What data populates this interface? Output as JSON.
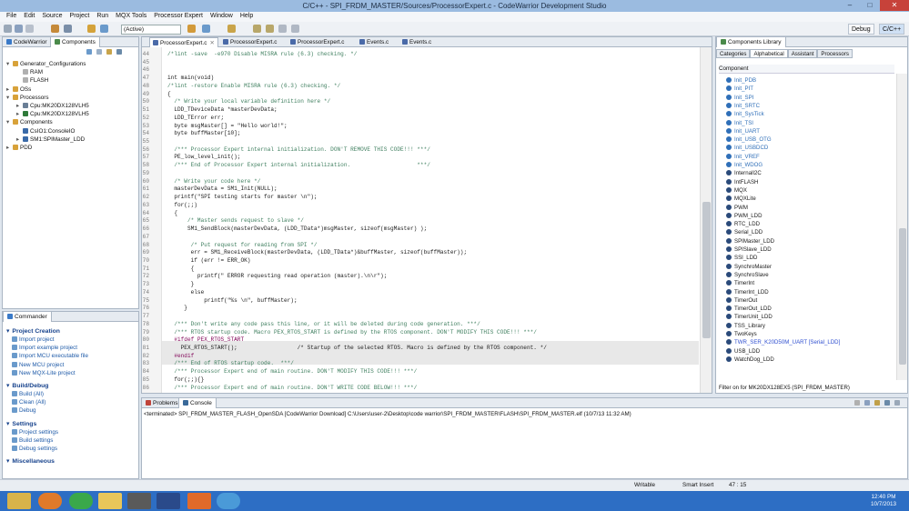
{
  "window": {
    "title": "C/C++ - SPI_FRDM_MASTER/Sources/ProcessorExpert.c - CodeWarrior Development Studio",
    "minimize": "–",
    "maximize": "□",
    "close": "✕"
  },
  "menu": [
    "File",
    "Edit",
    "Source",
    "Project",
    "Run",
    "MQX Tools",
    "Processor Expert",
    "Window",
    "Help"
  ],
  "toolbar": {
    "active_config": "(Active)",
    "perspectives": [
      "Debug",
      "C/C++"
    ]
  },
  "left_panel": {
    "tabs": [
      "CodeWarrior",
      "Components"
    ],
    "tree": [
      {
        "indent": 0,
        "label": "Generator_Configurations",
        "arrow": "▾",
        "color": "#d8a23a"
      },
      {
        "indent": 1,
        "label": "RAM",
        "arrow": "",
        "color": "#b0b0b0"
      },
      {
        "indent": 1,
        "label": "FLASH",
        "arrow": "",
        "color": "#b0b0b0"
      },
      {
        "indent": 0,
        "label": "OSs",
        "arrow": "▸",
        "color": "#d8a23a"
      },
      {
        "indent": 0,
        "label": "Processors",
        "arrow": "▾",
        "color": "#d8a23a"
      },
      {
        "indent": 1,
        "label": "Cpu:MK20DX128VLH5",
        "arrow": "▸",
        "color": "#6a7f96"
      },
      {
        "indent": 1,
        "label": "Cpu:MK20DX128VLH5",
        "arrow": "▸",
        "color": "#2f7a3a"
      },
      {
        "indent": 0,
        "label": "Components",
        "arrow": "▾",
        "color": "#d8a23a"
      },
      {
        "indent": 1,
        "label": "CsIO1:ConsoleIO",
        "arrow": "",
        "color": "#3a6aa8"
      },
      {
        "indent": 1,
        "label": "SM1:SPIMaster_LDD",
        "arrow": "▸",
        "color": "#3a6aa8"
      },
      {
        "indent": 0,
        "label": "PDD",
        "arrow": "▸",
        "color": "#d8a23a"
      }
    ]
  },
  "commander": {
    "title": "Commander",
    "sections": [
      {
        "title": "Project Creation",
        "items": [
          "Import project",
          "Import example project",
          "Import MCU executable file",
          "New MCU project",
          "New MQX-Lite project"
        ]
      },
      {
        "title": "Build/Debug",
        "items": [
          "Build  (All)",
          "Clean  (All)",
          "Debug"
        ]
      },
      {
        "title": "Settings",
        "items": [
          "Project settings",
          "Build settings",
          "Debug settings"
        ]
      },
      {
        "title": "Miscellaneous",
        "items": []
      }
    ]
  },
  "editor": {
    "tabs": [
      "ProcessorExpert.c",
      "ProcessorExpert.c",
      "ProcessorExpert.c",
      "Events.c",
      "Events.c"
    ],
    "lines": [
      {
        "n": "44",
        "t": "/*lint -save  -e970 Disable MISRA rule (6.3) checking. */",
        "c": "#3f7f5f"
      },
      {
        "n": "45",
        "t": "",
        "c": "#1a1a1a"
      },
      {
        "n": "46",
        "t": "",
        "c": "#1a1a1a"
      },
      {
        "n": "47",
        "t": "int main(void)",
        "c": "#1a1a1a"
      },
      {
        "n": "48",
        "t": "/*lint -restore Enable MISRA rule (6.3) checking. */",
        "c": "#3f7f5f"
      },
      {
        "n": "49",
        "t": "{",
        "c": "#1a1a1a"
      },
      {
        "n": "50",
        "t": "  /* Write your local variable definition here */",
        "c": "#3f7f5f"
      },
      {
        "n": "51",
        "t": "  LDD_TDeviceData *masterDevData;",
        "c": "#1a1a1a"
      },
      {
        "n": "52",
        "t": "  LDD_TError err;",
        "c": "#1a1a1a"
      },
      {
        "n": "53",
        "t": "  byte msgMaster[] = \"Hello world!\";",
        "c": "#1a1a1a"
      },
      {
        "n": "54",
        "t": "  byte buffMaster[10];",
        "c": "#1a1a1a"
      },
      {
        "n": "55",
        "t": "",
        "c": "#1a1a1a"
      },
      {
        "n": "56",
        "t": "  /*** Processor Expert internal initialization. DON'T REMOVE THIS CODE!!! ***/",
        "c": "#3f7f5f"
      },
      {
        "n": "57",
        "t": "  PE_low_level_init();",
        "c": "#1a1a1a"
      },
      {
        "n": "58",
        "t": "  /*** End of Processor Expert internal initialization.                    ***/",
        "c": "#3f7f5f"
      },
      {
        "n": "59",
        "t": "",
        "c": "#1a1a1a"
      },
      {
        "n": "60",
        "t": "  /* Write your code here */",
        "c": "#3f7f5f"
      },
      {
        "n": "61",
        "t": "  masterDevData = SM1_Init(NULL);",
        "c": "#1a1a1a"
      },
      {
        "n": "62",
        "t": "  printf(\"SPI testing starts for master \\n\");",
        "c": "#1a1a1a"
      },
      {
        "n": "63",
        "t": "  for(;;)",
        "c": "#1a1a1a"
      },
      {
        "n": "64",
        "t": "  {",
        "c": "#1a1a1a"
      },
      {
        "n": "65",
        "t": "      /* Master sends request to slave */",
        "c": "#3f7f5f"
      },
      {
        "n": "66",
        "t": "      SM1_SendBlock(masterDevData, (LDD_TData*)msgMaster, sizeof(msgMaster) );",
        "c": "#1a1a1a"
      },
      {
        "n": "67",
        "t": "",
        "c": "#1a1a1a"
      },
      {
        "n": "68",
        "t": "       /* Put request for reading from SPI */",
        "c": "#3f7f5f"
      },
      {
        "n": "69",
        "t": "       err = SM1_ReceiveBlock(masterDevData, (LDD_TData*)&buffMaster, sizeof(buffMaster));",
        "c": "#1a1a1a"
      },
      {
        "n": "70",
        "t": "       if (err != ERR_OK)",
        "c": "#1a1a1a"
      },
      {
        "n": "71",
        "t": "       {",
        "c": "#1a1a1a"
      },
      {
        "n": "72",
        "t": "         printf(\" ERROR requesting read operation (master).\\n\\r\");",
        "c": "#1a1a1a"
      },
      {
        "n": "73",
        "t": "       }",
        "c": "#1a1a1a"
      },
      {
        "n": "74",
        "t": "       else",
        "c": "#1a1a1a"
      },
      {
        "n": "75",
        "t": "           printf(\"%s \\n\", buffMaster);",
        "c": "#1a1a1a"
      },
      {
        "n": "76",
        "t": "     }",
        "c": "#1a1a1a"
      },
      {
        "n": "77",
        "t": "",
        "c": "#1a1a1a"
      },
      {
        "n": "78",
        "t": "  /*** Don't write any code pass this line, or it will be deleted during code generation. ***/",
        "c": "#3f7f5f"
      },
      {
        "n": "79",
        "t": "  /*** RTOS startup code. Macro PEX_RTOS_START is defined by the RTOS component. DON'T MODIFY THIS CODE!!! ***/",
        "c": "#3f7f5f"
      },
      {
        "n": "80",
        "t": "  #ifdef PEX_RTOS_START",
        "c": "#7f0055"
      },
      {
        "n": "81",
        "t": "    PEX_RTOS_START();                  /* Startup of the selected RTOS. Macro is defined by the RTOS component. */",
        "c": "#1a1a1a"
      },
      {
        "n": "82",
        "t": "  #endif",
        "c": "#7f0055"
      },
      {
        "n": "83",
        "t": "  /*** End of RTOS startup code.  ***/",
        "c": "#3f7f5f"
      },
      {
        "n": "84",
        "t": "  /*** Processor Expert end of main routine. DON'T MODIFY THIS CODE!!! ***/",
        "c": "#3f7f5f"
      },
      {
        "n": "85",
        "t": "  for(;;){}",
        "c": "#1a1a1a"
      },
      {
        "n": "86",
        "t": "  /*** Processor Expert end of main routine. DON'T WRITE CODE BELOW!!! ***/",
        "c": "#3f7f5f"
      }
    ]
  },
  "library": {
    "title": "Components Library",
    "tabs": [
      "Categories",
      "Alphabetical",
      "Assistant",
      "Processors"
    ],
    "header": "Component",
    "items": [
      {
        "label": "Init_PDB",
        "color": "#2f6fb8"
      },
      {
        "label": "Init_PIT",
        "color": "#2f6fb8"
      },
      {
        "label": "Init_SPI",
        "color": "#2f6fb8"
      },
      {
        "label": "Init_SRTC",
        "color": "#2f6fb8"
      },
      {
        "label": "Init_SysTick",
        "color": "#2f6fb8"
      },
      {
        "label": "Init_TSI",
        "color": "#2f6fb8"
      },
      {
        "label": "Init_UART",
        "color": "#2f6fb8"
      },
      {
        "label": "Init_USB_OTG",
        "color": "#2f6fb8"
      },
      {
        "label": "Init_USBDCD",
        "color": "#2f6fb8"
      },
      {
        "label": "Init_VREF",
        "color": "#2f6fb8"
      },
      {
        "label": "Init_WDOG",
        "color": "#2f6fb8"
      },
      {
        "label": "InternalI2C",
        "color": "#1a1a1a"
      },
      {
        "label": "IntFLASH",
        "color": "#1a1a1a"
      },
      {
        "label": "MQX",
        "color": "#1a1a1a"
      },
      {
        "label": "MQXLite",
        "color": "#1a1a1a"
      },
      {
        "label": "PWM",
        "color": "#1a1a1a"
      },
      {
        "label": "PWM_LDD",
        "color": "#1a1a1a"
      },
      {
        "label": "RTC_LDD",
        "color": "#1a1a1a"
      },
      {
        "label": "Serial_LDD",
        "color": "#1a1a1a"
      },
      {
        "label": "SPIMaster_LDD",
        "color": "#1a1a1a"
      },
      {
        "label": "SPISlave_LDD",
        "color": "#1a1a1a"
      },
      {
        "label": "SSI_LDD",
        "color": "#1a1a1a"
      },
      {
        "label": "SynchroMaster",
        "color": "#1a1a1a"
      },
      {
        "label": "SynchroSlave",
        "color": "#1a1a1a"
      },
      {
        "label": "TimerInt",
        "color": "#1a1a1a"
      },
      {
        "label": "TimerInt_LDD",
        "color": "#1a1a1a"
      },
      {
        "label": "TimerOut",
        "color": "#1a1a1a"
      },
      {
        "label": "TimerOut_LDD",
        "color": "#1a1a1a"
      },
      {
        "label": "TimerUnit_LDD",
        "color": "#1a1a1a"
      },
      {
        "label": "TSS_Library",
        "color": "#1a1a1a"
      },
      {
        "label": "TwoKeys",
        "color": "#1a1a1a"
      },
      {
        "label": "TWR_SER_K20D50M_UART [Serial_LDD]",
        "color": "#2f4fd0"
      },
      {
        "label": "USB_LDD",
        "color": "#1a1a1a"
      },
      {
        "label": "WatchDog_LDD",
        "color": "#1a1a1a"
      }
    ],
    "filter": "Filter on for MK20DX128EX5 (SPI_FRDM_MASTER)"
  },
  "console": {
    "tabs": [
      "Problems",
      "Console"
    ],
    "line": "<terminated> SPI_FRDM_MASTER_FLASH_OpenSDA [CodeWarrior Download] C:\\Users\\user-2\\Desktop\\code warrior\\SPI_FRDM_MASTER\\FLASH\\SPI_FRDM_MASTER.elf (10/7/13 11:32 AM)"
  },
  "status": {
    "writable": "Writable",
    "insert": "Smart Insert",
    "pos": "47 : 15"
  },
  "taskbar": {
    "time": "12:40 PM",
    "date": "10/7/2013"
  }
}
